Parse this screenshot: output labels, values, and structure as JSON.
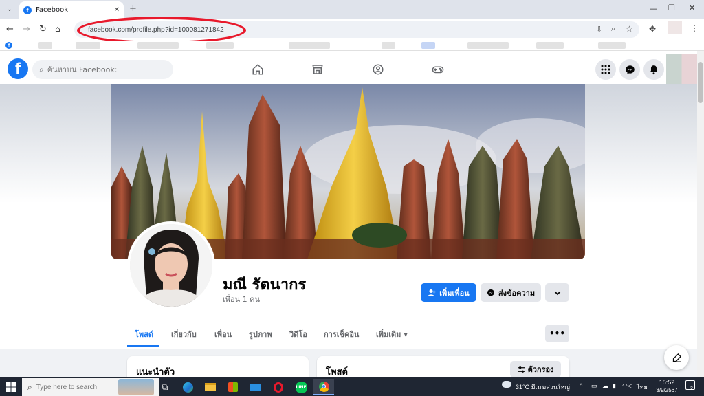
{
  "browser": {
    "tab_title": "Facebook",
    "new_tab": "+",
    "url": "facebook.com/profile.php?id=100081271842"
  },
  "facebook": {
    "logo": "f",
    "search_placeholder": "ค้นหาบน Facebook:"
  },
  "profile": {
    "name": "มณี รัตนากร",
    "friends": "เพื่อน 1 คน",
    "add_friend": "เพิ่มเพื่อน",
    "message": "ส่งข้อความ",
    "tabs": [
      "โพสต์",
      "เกี่ยวกับ",
      "เพื่อน",
      "รูปภาพ",
      "วิดีโอ",
      "การเช็คอิน",
      "เพิ่มเติม"
    ],
    "more_arrow": "▾",
    "intro_title": "แนะนำตัว",
    "posts_title": "โพสต์",
    "filter": "ตัวกรอง"
  },
  "taskbar": {
    "search_placeholder": "Type here to search",
    "weather": "31°C  มีเมฆส่วนใหญ่",
    "lang": "ไทย",
    "time": "15:52",
    "date": "3/9/2567",
    "notif_count": "2"
  },
  "colors": {
    "fb_blue": "#1877f2",
    "highlight_ring": "#e8192c"
  }
}
